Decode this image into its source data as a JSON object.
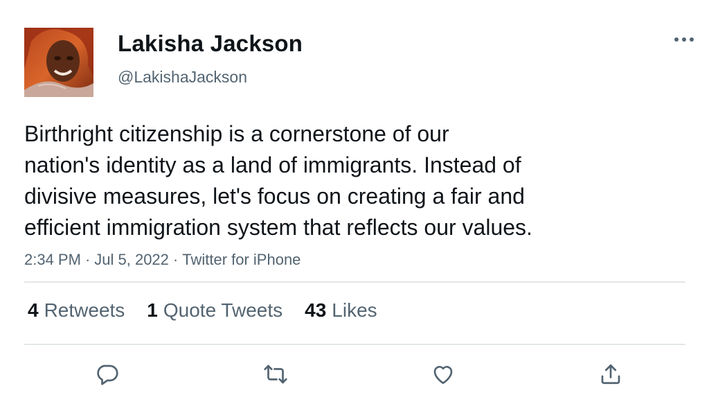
{
  "user": {
    "name": "Lakisha Jackson",
    "handle": "@LakishaJackson"
  },
  "tweet": {
    "text": "Birthright citizenship is a cornerstone of our\nnation's identity as a land of immigrants. Instead of\ndivisive measures, let's focus on creating a fair and\nefficient immigration system that reflects our values.",
    "time": "2:34 PM",
    "date": "Jul 5, 2022",
    "source": "Twitter for iPhone",
    "separator": "·"
  },
  "stats": {
    "retweets": {
      "count": "4",
      "label": "Retweets"
    },
    "quotes": {
      "count": "1",
      "label": "Quote Tweets"
    },
    "likes": {
      "count": "43",
      "label": "Likes"
    }
  },
  "icons": {
    "more": "more-icon",
    "reply": "reply-icon",
    "retweet": "retweet-icon",
    "like": "like-icon",
    "share": "share-icon"
  },
  "colors": {
    "text": "#0f1419",
    "secondary": "#536471",
    "divider": "#e4e6e8"
  }
}
